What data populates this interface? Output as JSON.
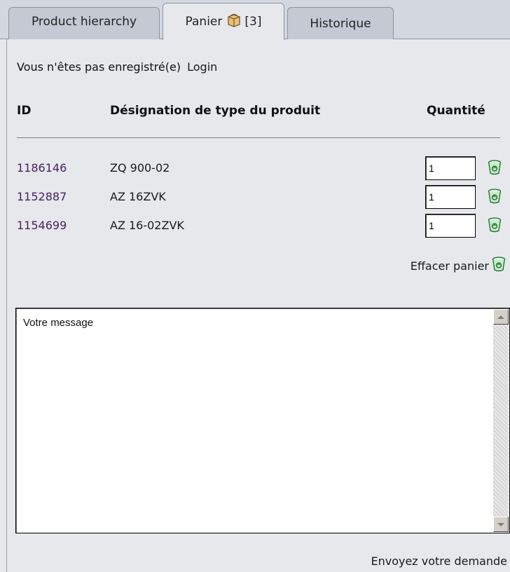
{
  "tabs": [
    {
      "label": "Product hierarchy"
    },
    {
      "label": "Panier",
      "count": "[3]"
    },
    {
      "label": "Historique"
    }
  ],
  "login": {
    "text": "Vous n'êtes pas enregistré(e)",
    "link": "Login"
  },
  "table": {
    "headers": {
      "id": "ID",
      "designation": "Désignation de type du produit",
      "quantity": "Quantité"
    },
    "rows": [
      {
        "id": "1186146",
        "name": "ZQ 900-02",
        "qty": "1"
      },
      {
        "id": "1152887",
        "name": "AZ 16ZVK",
        "qty": "1"
      },
      {
        "id": "1154699",
        "name": "AZ 16-02ZVK",
        "qty": "1"
      }
    ]
  },
  "clear_cart": "Effacer panier",
  "message": {
    "value": "Votre message"
  },
  "send": "Envoyez votre demande",
  "icons": {
    "cart": "cart-icon",
    "trash": "trash-icon"
  },
  "colors": {
    "background": "#e6e8ec",
    "tabbar": "#d3d7e0",
    "id_text": "#4a2060",
    "trash_green": "#2e9e3a"
  }
}
